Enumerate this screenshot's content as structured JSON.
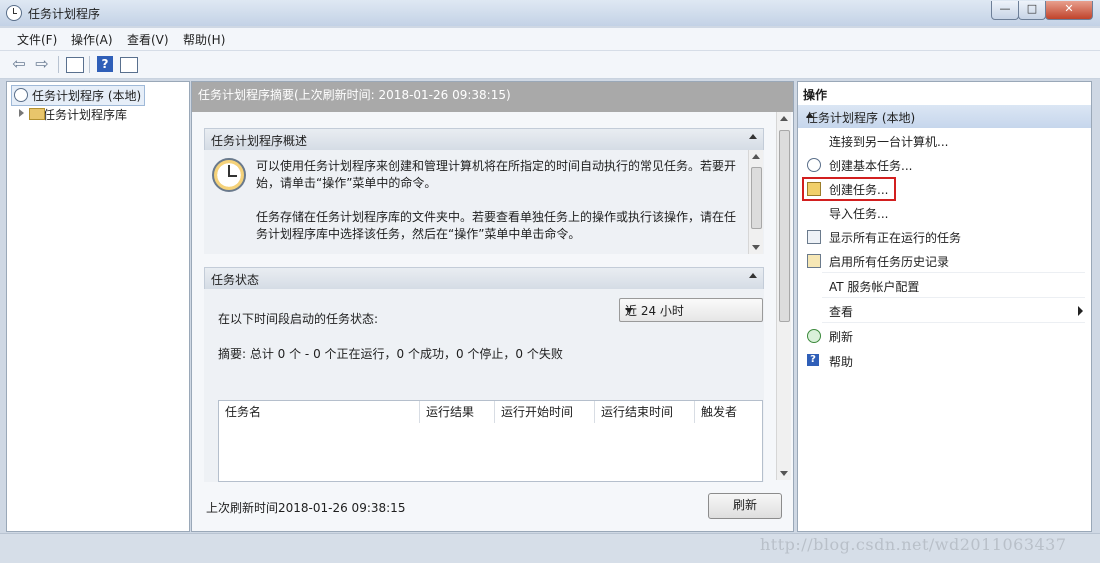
{
  "window": {
    "title": "任务计划程序",
    "controls": {
      "minimize": "—",
      "maximize": "□",
      "close": "✕"
    }
  },
  "menu": [
    "文件(F)",
    "操作(A)",
    "查看(V)",
    "帮助(H)"
  ],
  "toolbar": {
    "back_glyph": "⇦",
    "forward_glyph": "⇨",
    "help_glyph": "?"
  },
  "tree": {
    "root": "任务计划程序 (本地)",
    "library": "任务计划程序库"
  },
  "center": {
    "header": "任务计划程序摘要(上次刷新时间: 2018-01-26 09:38:15)",
    "overview": {
      "title": "任务计划程序概述",
      "text1": "可以使用任务计划程序来创建和管理计算机将在所指定的时间自动执行的常见任务。若要开始，请单击“操作”菜单中的命令。",
      "text2": "任务存储在任务计划程序库的文件夹中。若要查看单独任务上的操作或执行该操作，请在任务计划程序库中选择该任务，然后在“操作”菜单中单击命令。"
    },
    "status": {
      "title": "任务状态",
      "label": "在以下时间段启动的任务状态:",
      "dropdown_value": "近 24 小时",
      "summary": "摘要: 总计 0 个 - 0 个正在运行，0 个成功，0 个停止，0 个失败",
      "columns": [
        "任务名",
        "运行结果",
        "运行开始时间",
        "运行结束时间",
        "触发者"
      ]
    },
    "last_refresh": "上次刷新时间2018-01-26 09:38:15",
    "refresh_button": "刷新"
  },
  "actions": {
    "title": "操作",
    "group": "任务计划程序 (本地)",
    "items": [
      {
        "label": "连接到另一台计算机...",
        "icon": "none"
      },
      {
        "label": "创建基本任务...",
        "icon": "clock-icon"
      },
      {
        "label": "创建任务...",
        "icon": "task-icon",
        "highlighted": true
      },
      {
        "label": "导入任务...",
        "icon": "none"
      },
      {
        "label": "显示所有正在运行的任务",
        "icon": "running-tasks-icon"
      },
      {
        "label": "启用所有任务历史记录",
        "icon": "history-icon"
      },
      {
        "label": "AT 服务帐户配置",
        "icon": "none"
      },
      {
        "label": "查看",
        "icon": "none",
        "submenu": true
      },
      {
        "label": "刷新",
        "icon": "refresh-icon"
      },
      {
        "label": "帮助",
        "icon": "help-icon"
      }
    ]
  },
  "watermark": "http://blog.csdn.net/wd2011063437",
  "colors": {
    "highlight_border": "#d21f1f",
    "header_gray": "#a9a9a9",
    "group_blue": "#c6d6ec"
  }
}
